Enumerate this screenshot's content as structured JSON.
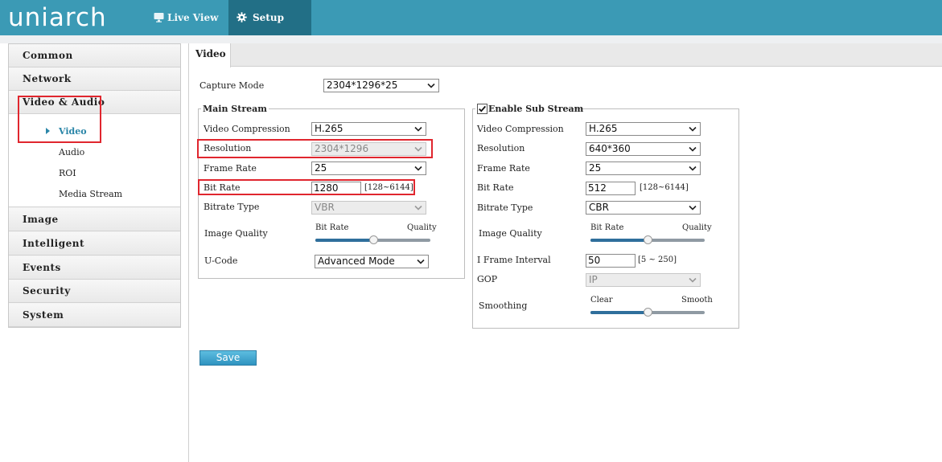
{
  "app": {
    "logo": "uniarch",
    "nav": [
      {
        "label": "Live View",
        "icon": "monitor-icon"
      },
      {
        "label": "Setup",
        "icon": "gear-icon"
      }
    ]
  },
  "sidebar": {
    "items": [
      {
        "label": "Common"
      },
      {
        "label": "Network"
      },
      {
        "label": "Video & Audio"
      },
      {
        "label": "Image"
      },
      {
        "label": "Intelligent"
      },
      {
        "label": "Events"
      },
      {
        "label": "Security"
      },
      {
        "label": "System"
      }
    ],
    "submenu": [
      {
        "label": "Video",
        "active": true
      },
      {
        "label": "Audio"
      },
      {
        "label": "ROI"
      },
      {
        "label": "Media Stream"
      }
    ]
  },
  "page": {
    "tab": "Video",
    "capture_mode": {
      "label": "Capture Mode",
      "value": "2304*1296*25"
    },
    "save_label": "Save"
  },
  "main_stream": {
    "title": "Main Stream",
    "video_compression": {
      "label": "Video Compression",
      "value": "H.265"
    },
    "resolution": {
      "label": "Resolution",
      "value": "2304*1296"
    },
    "frame_rate": {
      "label": "Frame Rate",
      "value": "25"
    },
    "bit_rate": {
      "label": "Bit Rate",
      "value": "1280",
      "range": "[128~6144]"
    },
    "bitrate_type": {
      "label": "Bitrate Type",
      "value": "VBR"
    },
    "image_quality": {
      "label": "Image Quality",
      "left": "Bit Rate",
      "right": "Quality",
      "level": 0.5
    },
    "u_code": {
      "label": "U-Code",
      "value": "Advanced Mode"
    }
  },
  "sub_stream": {
    "title": "Enable Sub Stream",
    "enabled": true,
    "video_compression": {
      "label": "Video Compression",
      "value": "H.265"
    },
    "resolution": {
      "label": "Resolution",
      "value": "640*360"
    },
    "frame_rate": {
      "label": "Frame Rate",
      "value": "25"
    },
    "bit_rate": {
      "label": "Bit Rate",
      "value": "512",
      "range": "[128~6144]"
    },
    "bitrate_type": {
      "label": "Bitrate Type",
      "value": "CBR"
    },
    "image_quality": {
      "label": "Image Quality",
      "left": "Bit Rate",
      "right": "Quality",
      "level": 0.5
    },
    "i_frame_interval": {
      "label": "I Frame Interval",
      "value": "50",
      "range": "[5 ~ 250]"
    },
    "gop": {
      "label": "GOP",
      "value": "IP"
    },
    "smoothing": {
      "label": "Smoothing",
      "left": "Clear",
      "right": "Smooth",
      "level": 0.5
    }
  },
  "colors": {
    "header": "#3b9ab5",
    "header_active": "#226f86",
    "accent": "#2b86a8",
    "highlight": "#e0262e"
  }
}
